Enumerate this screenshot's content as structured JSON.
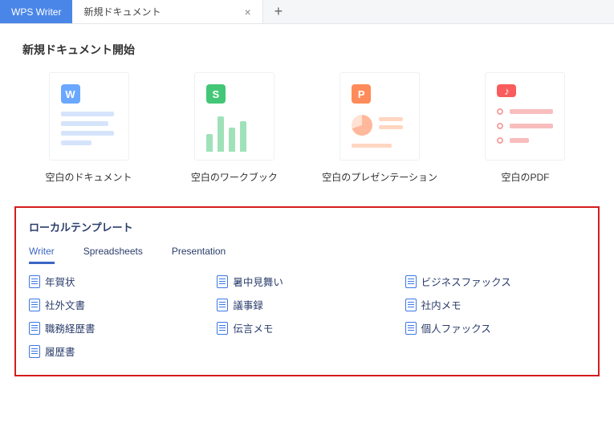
{
  "tabs": {
    "app": "WPS Writer",
    "doc": "新規ドキュメント"
  },
  "newDoc": {
    "title": "新規ドキュメント開始",
    "cards": {
      "writer": "空白のドキュメント",
      "sheet": "空白のワークブック",
      "presentation": "空白のプレゼンテーション",
      "pdf": "空白のPDF"
    }
  },
  "local": {
    "title": "ローカルテンプレート",
    "tabs": {
      "writer": "Writer",
      "spreadsheets": "Spreadsheets",
      "presentation": "Presentation"
    },
    "items": [
      "年賀状",
      "暑中見舞い",
      "ビジネスファックス",
      "社外文書",
      "議事録",
      "社内メモ",
      "職務経歴書",
      "伝言メモ",
      "個人ファックス",
      "履歴書"
    ]
  }
}
